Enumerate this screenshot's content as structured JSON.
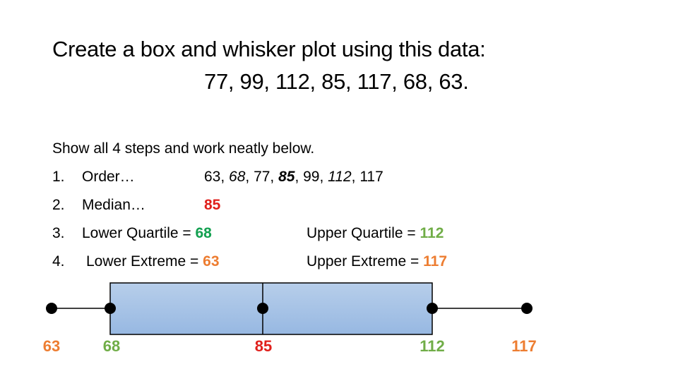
{
  "title": {
    "line1": "Create a box and whisker plot using this data:",
    "line2": "77, 99, 112, 85, 117, 68, 63."
  },
  "instructions": "Show all 4 steps and work neatly below.",
  "steps": {
    "order": {
      "number": "1.",
      "label": "Order…",
      "values": [
        "63",
        "68",
        "77",
        "85",
        "99",
        "112",
        "117"
      ],
      "separator": ", "
    },
    "median": {
      "number": "2.",
      "label": "Median…",
      "value": "85"
    },
    "quartiles": {
      "number": "3.",
      "lower_label": "Lower Quartile = ",
      "lower_value": "68",
      "upper_label": "Upper Quartile = ",
      "upper_value": "112"
    },
    "extremes": {
      "number": "4.",
      "lower_label": "Lower Extreme = ",
      "lower_value": "63",
      "upper_label": "Upper Extreme = ",
      "upper_value": "117"
    }
  },
  "colors": {
    "median": "#E0201C",
    "lower_quartile_text": "#13A050",
    "quartile": "#70AD47",
    "extreme": "#ED7D31",
    "box_top": "#B7CEEA",
    "box_bottom": "#97B8E2"
  },
  "chart_data": {
    "type": "boxplot",
    "data": [
      77,
      99,
      112,
      85,
      117,
      68,
      63
    ],
    "min": 63,
    "q1": 68,
    "median": 85,
    "q3": 112,
    "max": 117,
    "labels": {
      "min": "63",
      "q1": "68",
      "median": "85",
      "q3": "112",
      "max": "117"
    }
  }
}
